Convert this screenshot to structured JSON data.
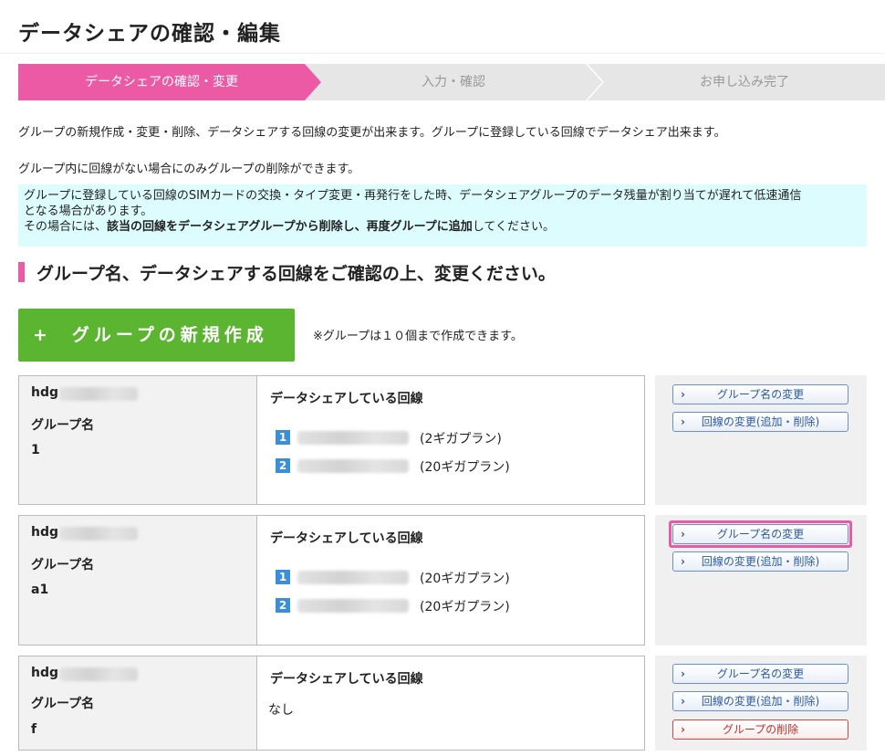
{
  "page": {
    "title": "データシェアの確認・編集"
  },
  "steps": [
    {
      "label": "データシェアの確認・変更",
      "active": true
    },
    {
      "label": "入力・確認",
      "active": false
    },
    {
      "label": "お申し込み完了",
      "active": false
    }
  ],
  "intro": {
    "line1": "グループの新規作成・変更・削除、データシェアする回線の変更が出来ます。グループに登録している回線でデータシェア出来ます。",
    "line2": "グループ内に回線がない場合にのみグループの削除ができます。"
  },
  "notice": {
    "line1": "グループに登録している回線のSIMカードの交換・タイプ変更・再発行をした時、データシェアグループのデータ残量が割り当てが遅れて低速通信",
    "line2": "となる場合があります。",
    "line3_prefix": "その場合には、",
    "line3_bold": "該当の回線をデータシェアグループから削除し、再度グループに追加",
    "line3_suffix": "してください。"
  },
  "section": {
    "heading": "グループ名、データシェアする回線をご確認の上、変更ください。"
  },
  "new_group": {
    "plus": "+",
    "label": "グループの新規作成",
    "note": "※グループは１０個まで作成できます。"
  },
  "groups": [
    {
      "id_prefix": "hdg",
      "name_label": "グループ名",
      "name": "1",
      "lines_title": "データシェアしている回線",
      "lines": [
        {
          "num": "1",
          "plan": "(2ギガプラン)"
        },
        {
          "num": "2",
          "plan": "(20ギガプラン)"
        }
      ],
      "none_text": "",
      "actions": {
        "rename": "グループ名の変更",
        "edit_lines": "回線の変更(追加・削除)"
      }
    },
    {
      "id_prefix": "hdg",
      "name_label": "グループ名",
      "name": "a1",
      "lines_title": "データシェアしている回線",
      "lines": [
        {
          "num": "1",
          "plan": "(20ギガプラン)"
        },
        {
          "num": "2",
          "plan": "(20ギガプラン)"
        }
      ],
      "none_text": "",
      "actions": {
        "rename": "グループ名の変更",
        "edit_lines": "回線の変更(追加・削除)"
      }
    },
    {
      "id_prefix": "hdg",
      "name_label": "グループ名",
      "name": "f",
      "lines_title": "データシェアしている回線",
      "lines": [],
      "none_text": "なし",
      "actions": {
        "rename": "グループ名の変更",
        "edit_lines": "回線の変更(追加・削除)",
        "delete": "グループの削除"
      }
    }
  ],
  "icons": {
    "action_arrow": "chevron-right-icon",
    "arrow_glyph": "›"
  },
  "colors": {
    "accent_pink": "#ec5aa6",
    "new_button_green": "#5cb531",
    "line_badge_blue": "#3a8fd8",
    "notice_bg": "#ddfcfe"
  }
}
